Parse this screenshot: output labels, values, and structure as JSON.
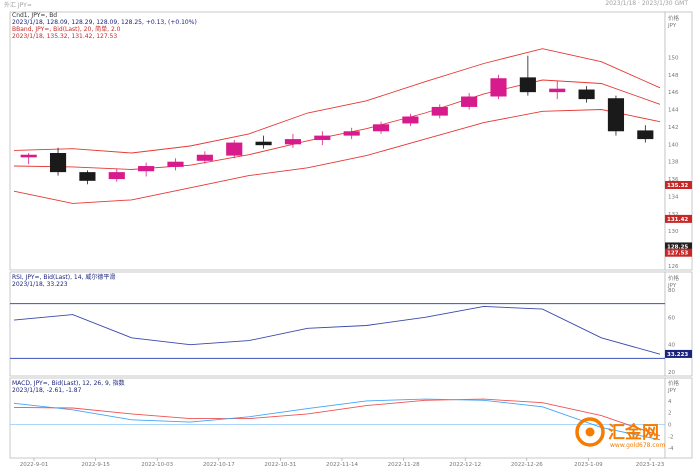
{
  "header": {
    "symbol": "外汇 JPY=",
    "datetime": "2023/1/18 · 2023/1/30 GMT"
  },
  "price_panel": {
    "title_line": "Cnd1, JPY=, Bd",
    "ohlc_line": "2023/1/18, 128.09, 128.29, 128.09, 128.25, +0.13, (+0.10%)",
    "bband_title": "BBand, JPY=, Bid(Last), 20, 简单, 2.0",
    "bband_values": "2023/1/18, 135.32, 131.42, 127.53",
    "y_labels": [
      "价格",
      "JPY",
      "150",
      "148",
      "146",
      "144",
      "142",
      "140",
      "138",
      "136",
      "134",
      "132",
      "130",
      "128",
      "126"
    ],
    "markers": [
      {
        "label": "135.32",
        "value": 135.32,
        "color": "#c62828"
      },
      {
        "label": "131.42",
        "value": 131.42,
        "color": "#c62828"
      },
      {
        "label": "128.25",
        "value": 128.25,
        "color": "#202020"
      },
      {
        "label": "127.53",
        "value": 127.53,
        "color": "#c62828"
      }
    ]
  },
  "rsi_panel": {
    "title_line": "RSI, JPY=, Bid(Last), 14, 威尔德平滑",
    "value_line": "2023/1/18, 33.223",
    "y_labels": [
      "价格",
      "JPY",
      "80",
      "60",
      "40",
      "20"
    ],
    "marker": {
      "label": "33.223",
      "value": 33.223,
      "color": "#1a237e"
    }
  },
  "macd_panel": {
    "title_line": "MACD, JPY=, Bid(Last), 12, 26, 9, 指数",
    "value_line": "2023/1/18, -2.61, -1.87",
    "y_labels": [
      "价格",
      "JPY",
      "4",
      "2",
      "0",
      "-2",
      "-4"
    ]
  },
  "x_labels": [
    "2022-9-01",
    "2022-9-15",
    "2022-10-03",
    "2022-10-17",
    "2022-10-31",
    "2022-11-14",
    "2022-11-28",
    "2022-12-12",
    "2022-12-26",
    "2023-1-09",
    "2023-1-23"
  ],
  "watermark": {
    "text": "汇金网",
    "sub": "www.gold678.com"
  },
  "colors": {
    "up": "#d81b8c",
    "down": "#1a1a1a",
    "bband": "#e53935",
    "rsi": "#3949ab",
    "macd_line": "#42a5f5",
    "macd_signal": "#ef5350",
    "ref_line": "#3f51b5",
    "watermark": "#f57c00"
  },
  "chart_data": [
    {
      "type": "candlestick",
      "title": "Cnd1, JPY=, Bd",
      "x_range": [
        "2022-08-29",
        "2023-01-30"
      ],
      "ylim": [
        126,
        152
      ],
      "candles": [
        {
          "d": "2022-08-29",
          "o": 138.5,
          "h": 139.0,
          "l": 137.7,
          "c": 138.8
        },
        {
          "d": "2022-09-05",
          "o": 139.0,
          "h": 139.6,
          "l": 136.4,
          "c": 136.8
        },
        {
          "d": "2022-09-12",
          "o": 136.8,
          "h": 137.0,
          "l": 135.4,
          "c": 135.8
        },
        {
          "d": "2022-09-19",
          "o": 136.0,
          "h": 137.2,
          "l": 135.7,
          "c": 136.8
        },
        {
          "d": "2022-09-26",
          "o": 136.9,
          "h": 137.9,
          "l": 136.3,
          "c": 137.5
        },
        {
          "d": "2022-10-03",
          "o": 137.4,
          "h": 138.4,
          "l": 137.0,
          "c": 138.0
        },
        {
          "d": "2022-10-10",
          "o": 138.1,
          "h": 139.2,
          "l": 137.8,
          "c": 138.8
        },
        {
          "d": "2022-10-17",
          "o": 138.7,
          "h": 140.5,
          "l": 138.4,
          "c": 140.2
        },
        {
          "d": "2022-10-24",
          "o": 140.3,
          "h": 141.0,
          "l": 139.5,
          "c": 139.9
        },
        {
          "d": "2022-10-31",
          "o": 140.0,
          "h": 141.2,
          "l": 139.6,
          "c": 140.6
        },
        {
          "d": "2022-11-07",
          "o": 140.5,
          "h": 141.5,
          "l": 139.9,
          "c": 141.0
        },
        {
          "d": "2022-11-14",
          "o": 141.0,
          "h": 141.9,
          "l": 140.6,
          "c": 141.5
        },
        {
          "d": "2022-11-21",
          "o": 141.5,
          "h": 142.6,
          "l": 141.2,
          "c": 142.3
        },
        {
          "d": "2022-11-28",
          "o": 142.4,
          "h": 143.5,
          "l": 142.1,
          "c": 143.2
        },
        {
          "d": "2022-12-05",
          "o": 143.3,
          "h": 144.6,
          "l": 143.0,
          "c": 144.3
        },
        {
          "d": "2022-12-12",
          "o": 144.3,
          "h": 145.9,
          "l": 144.0,
          "c": 145.5
        },
        {
          "d": "2022-12-19",
          "o": 145.5,
          "h": 148.0,
          "l": 145.2,
          "c": 147.6
        },
        {
          "d": "2022-12-26",
          "o": 147.7,
          "h": 150.2,
          "l": 145.6,
          "c": 146.0
        },
        {
          "d": "2023-01-02",
          "o": 146.0,
          "h": 147.3,
          "l": 145.2,
          "c": 146.4
        },
        {
          "d": "2023-01-09",
          "o": 146.3,
          "h": 146.7,
          "l": 144.8,
          "c": 145.2
        },
        {
          "d": "2023-01-16",
          "o": 145.3,
          "h": 145.6,
          "l": 141.0,
          "c": 141.5
        },
        {
          "d": "2023-01-23",
          "o": 141.6,
          "h": 142.2,
          "l": 140.2,
          "c": 140.6
        }
      ]
    },
    {
      "type": "line",
      "title": "BBand, JPY=, Bid(Last), 20, 简单, 2.0",
      "x_range": [
        "2022-08-29",
        "2023-01-30"
      ],
      "ylim": [
        126,
        152
      ],
      "series": [
        {
          "name": "upper",
          "x": [
            "2022-08-29",
            "2022-09-12",
            "2022-09-26",
            "2022-10-10",
            "2022-10-24",
            "2022-11-07",
            "2022-11-21",
            "2022-12-05",
            "2022-12-19",
            "2023-01-02",
            "2023-01-16",
            "2023-01-30"
          ],
          "values": [
            139.3,
            139.5,
            139.0,
            139.8,
            141.2,
            143.6,
            145.0,
            147.2,
            149.3,
            151.0,
            149.5,
            146.5
          ]
        },
        {
          "name": "middle",
          "x": [
            "2022-08-29",
            "2022-09-12",
            "2022-09-26",
            "2022-10-10",
            "2022-10-24",
            "2022-11-07",
            "2022-11-21",
            "2022-12-05",
            "2022-12-19",
            "2023-01-02",
            "2023-01-16",
            "2023-01-30"
          ],
          "values": [
            137.5,
            137.4,
            137.1,
            137.6,
            138.8,
            140.4,
            141.8,
            143.6,
            145.8,
            147.4,
            147.0,
            144.6
          ]
        },
        {
          "name": "lower",
          "x": [
            "2022-08-29",
            "2022-09-12",
            "2022-09-26",
            "2022-10-10",
            "2022-10-24",
            "2022-11-07",
            "2022-11-21",
            "2022-12-05",
            "2022-12-19",
            "2023-01-02",
            "2023-01-16",
            "2023-01-30"
          ],
          "values": [
            134.6,
            133.2,
            133.6,
            135.0,
            136.4,
            137.3,
            138.7,
            140.6,
            142.5,
            143.8,
            144.0,
            142.6
          ]
        }
      ]
    },
    {
      "type": "line",
      "title": "RSI, JPY=, Bid(Last), 14, 威尔德平滑",
      "x_range": [
        "2022-08-29",
        "2023-01-30"
      ],
      "ylim": [
        20,
        80
      ],
      "ref_lines": [
        70,
        30
      ],
      "series": [
        {
          "name": "RSI",
          "x": [
            "2022-08-29",
            "2022-09-12",
            "2022-09-26",
            "2022-10-10",
            "2022-10-24",
            "2022-11-07",
            "2022-11-21",
            "2022-12-05",
            "2022-12-19",
            "2023-01-02",
            "2023-01-16",
            "2023-01-30"
          ],
          "values": [
            58,
            62,
            45,
            40,
            43,
            52,
            54,
            60,
            68,
            66,
            45,
            33
          ]
        }
      ]
    },
    {
      "type": "line",
      "title": "MACD, JPY=, Bid(Last), 12, 26, 9, 指数",
      "x_range": [
        "2022-08-29",
        "2023-01-30"
      ],
      "ylim": [
        -5,
        5
      ],
      "ref_lines": [
        0
      ],
      "series": [
        {
          "name": "MACD",
          "x": [
            "2022-08-29",
            "2022-09-12",
            "2022-09-26",
            "2022-10-10",
            "2022-10-24",
            "2022-11-07",
            "2022-11-21",
            "2022-12-05",
            "2022-12-19",
            "2023-01-02",
            "2023-01-16",
            "2023-01-30"
          ],
          "values": [
            3.6,
            2.5,
            0.8,
            0.4,
            1.3,
            2.7,
            4.0,
            4.3,
            4.1,
            3.0,
            -0.5,
            -2.6
          ]
        },
        {
          "name": "Signal",
          "x": [
            "2022-08-29",
            "2022-09-12",
            "2022-09-26",
            "2022-10-10",
            "2022-10-24",
            "2022-11-07",
            "2022-11-21",
            "2022-12-05",
            "2022-12-19",
            "2023-01-02",
            "2023-01-16",
            "2023-01-30"
          ],
          "values": [
            2.9,
            2.8,
            1.8,
            1.0,
            1.0,
            1.8,
            3.2,
            4.1,
            4.3,
            3.7,
            1.5,
            -1.9
          ]
        }
      ]
    }
  ]
}
